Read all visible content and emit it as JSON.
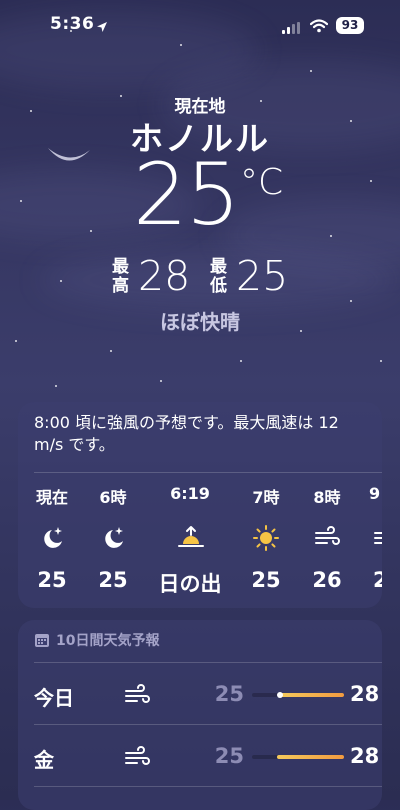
{
  "status_bar": {
    "time": "5:36",
    "battery": "93"
  },
  "header": {
    "location_label": "現在地",
    "city": "ホノルル",
    "temperature": "25",
    "unit": "°C",
    "high_label": "最高",
    "high": "28",
    "low_label": "最低",
    "low": "25",
    "condition": "ほぼ快晴"
  },
  "hourly": {
    "alert": "8:00 頃に強風の予想です。最大風速は 12 m/s です。",
    "items": [
      {
        "label": "現在",
        "icon": "moon-stars-icon",
        "temp": "25"
      },
      {
        "label": "6時",
        "icon": "moon-stars-icon",
        "temp": "25"
      },
      {
        "label": "6:19",
        "icon": "sunrise-icon",
        "temp": "日の出"
      },
      {
        "label": "7時",
        "icon": "sun-icon",
        "temp": "25"
      },
      {
        "label": "8時",
        "icon": "wind-icon",
        "temp": "26"
      },
      {
        "label": "9",
        "icon": "wind-icon",
        "temp": "2"
      }
    ]
  },
  "daily": {
    "title": "10日間天気予報",
    "items": [
      {
        "day": "今日",
        "icon": "wind-icon",
        "low": "25",
        "high": "28",
        "range_start": 0.3,
        "range_end": 1.0,
        "current": 0.3
      },
      {
        "day": "金",
        "icon": "wind-icon",
        "low": "25",
        "high": "28",
        "range_start": 0.27,
        "range_end": 1.0
      }
    ]
  },
  "colors": {
    "sky_top": "#2c2d55",
    "sky_mid": "#3b3d6b",
    "bar_start": "#f4c95c",
    "bar_end": "#f29b40",
    "sun": "#f6c445"
  }
}
